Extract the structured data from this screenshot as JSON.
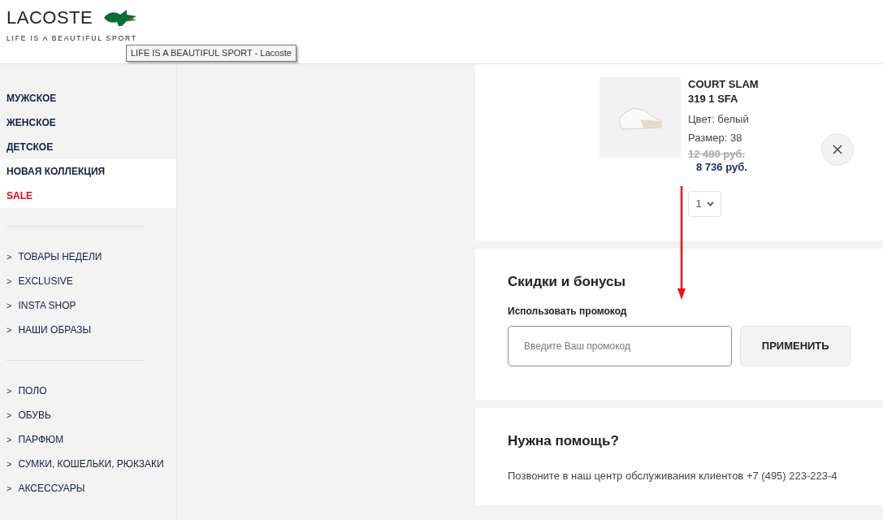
{
  "header": {
    "logo": "LACOSTE",
    "tagline": "LIFE IS A BEAUTIFUL SPORT",
    "tooltip": "LIFE IS A BEAUTIFUL SPORT - Lacoste"
  },
  "sidebar": {
    "main_items": [
      {
        "label": "МУЖСКОЕ",
        "highlighted": false,
        "kind": "normal"
      },
      {
        "label": "ЖЕНСКОЕ",
        "highlighted": false,
        "kind": "normal"
      },
      {
        "label": "ДЕТСКОЕ",
        "highlighted": false,
        "kind": "normal"
      },
      {
        "label": "НОВАЯ КОЛЛЕКЦИЯ",
        "highlighted": true,
        "kind": "normal"
      },
      {
        "label": "SALE",
        "highlighted": true,
        "kind": "sale"
      }
    ],
    "groups": [
      {
        "items": [
          {
            "label": "ТОВАРЫ НЕДЕЛИ"
          },
          {
            "label": "EXCLUSIVE"
          },
          {
            "label": "INSTA SHOP"
          },
          {
            "label": "НАШИ ОБРАЗЫ"
          }
        ]
      },
      {
        "items": [
          {
            "label": "ПОЛО"
          },
          {
            "label": "ОБУВЬ"
          },
          {
            "label": "ПАРФЮМ"
          },
          {
            "label": "СУМКИ, КОШЕЛЬКИ, РЮКЗАКИ"
          },
          {
            "label": "АКСЕССУАРЫ"
          }
        ]
      }
    ],
    "chevron": ">"
  },
  "cart_item": {
    "name_line_1": "COURT SLAM",
    "name_line_2": "319 1 SFA",
    "colour_label": "Цвет: белый",
    "size": "Размер: 38",
    "old_price": "12 480 руб.",
    "price": "8 736 руб.",
    "quantity": "1"
  },
  "promo": {
    "title": "Скидки и бонусы",
    "label": "Использовать промокод",
    "placeholder": "Введите Ваш промокод",
    "button": "ПРИМЕНИТЬ"
  },
  "help": {
    "title": "Нужна помощь?",
    "text": "Позвоните в наш центр обслуживания клиентов +7 (495) 223-223-4"
  }
}
